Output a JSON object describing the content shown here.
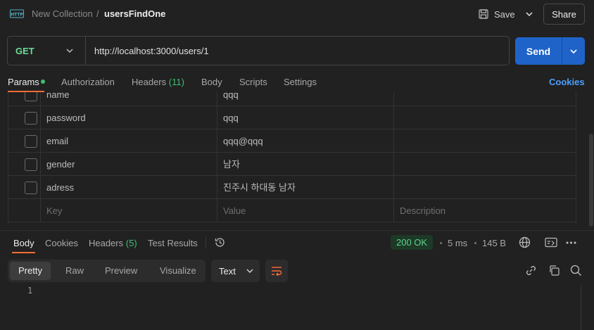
{
  "header": {
    "collection": "New Collection",
    "separator": "/",
    "request_name": "usersFindOne",
    "save_label": "Save",
    "share_label": "Share"
  },
  "request": {
    "method": "GET",
    "url": "http://localhost:3000/users/1",
    "send_label": "Send"
  },
  "request_tabs": {
    "params": "Params",
    "authorization": "Authorization",
    "headers": "Headers",
    "headers_count": "(11)",
    "body": "Body",
    "scripts": "Scripts",
    "settings": "Settings",
    "cookies": "Cookies"
  },
  "params": {
    "rows": [
      {
        "key": "name",
        "value": "qqq"
      },
      {
        "key": "password",
        "value": "qqq"
      },
      {
        "key": "email",
        "value": "qqq@qqq"
      },
      {
        "key": "gender",
        "value": "남자"
      },
      {
        "key": "adress",
        "value": "진주시 하대동 남자"
      }
    ],
    "placeholder": {
      "key": "Key",
      "value": "Value",
      "description": "Description"
    }
  },
  "response_tabs": {
    "body": "Body",
    "cookies": "Cookies",
    "headers": "Headers",
    "headers_count": "(5)",
    "test_results": "Test Results"
  },
  "response_meta": {
    "status": "200 OK",
    "time": "5 ms",
    "size": "145 B"
  },
  "response_toolbar": {
    "pretty": "Pretty",
    "raw": "Raw",
    "preview": "Preview",
    "visualize": "Visualize",
    "language": "Text"
  },
  "response_body": {
    "line_number": "1"
  },
  "colors": {
    "accent_orange": "#ff6c37",
    "send_blue": "#1f63c9",
    "method_green": "#6bdd9a",
    "status_green": "#5fd18f",
    "link_blue": "#4ca0ff"
  }
}
